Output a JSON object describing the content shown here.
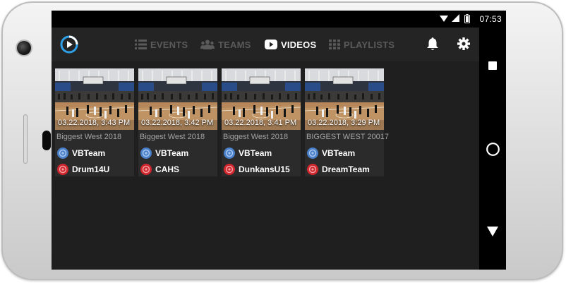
{
  "status_bar": {
    "time": "07:53",
    "icons": [
      "wifi-icon",
      "signal-icon",
      "battery-icon"
    ]
  },
  "app_bar": {
    "logo_icon": "app-logo-icon",
    "tabs": [
      {
        "label": "EVENTS",
        "icon": "list-icon",
        "active": false
      },
      {
        "label": "TEAMS",
        "icon": "group-icon",
        "active": false
      },
      {
        "label": "VIDEOS",
        "icon": "youtube-icon",
        "active": true
      },
      {
        "label": "PLAYLISTS",
        "icon": "grid-icon",
        "active": false
      }
    ],
    "actions": [
      "bell-icon",
      "gear-icon"
    ]
  },
  "nav_bar": [
    "recents-icon",
    "home-icon",
    "back-icon"
  ],
  "colors": {
    "home_team": "#4a80c8",
    "away_team": "#d0262e",
    "active_tab": "#ffffff",
    "inactive_tab": "#5a5a5a"
  },
  "videos": [
    {
      "date": "03.22.2018, 3:43 PM",
      "title": "Biggest West 2018",
      "home_team": "VBTeam",
      "away_team": "Drum14U"
    },
    {
      "date": "03.22.2018, 3:42 PM",
      "title": "Biggest West 2018",
      "home_team": "VBTeam",
      "away_team": "CAHS"
    },
    {
      "date": "03.22.2018, 3:41 PM",
      "title": "Biggest West 2018",
      "home_team": "VBTeam",
      "away_team": "DunkansU15"
    },
    {
      "date": "03.22.2018, 3:29 PM",
      "title": "BIGGEST WEST 20017",
      "home_team": "VBTeam",
      "away_team": "DreamTeam"
    }
  ]
}
